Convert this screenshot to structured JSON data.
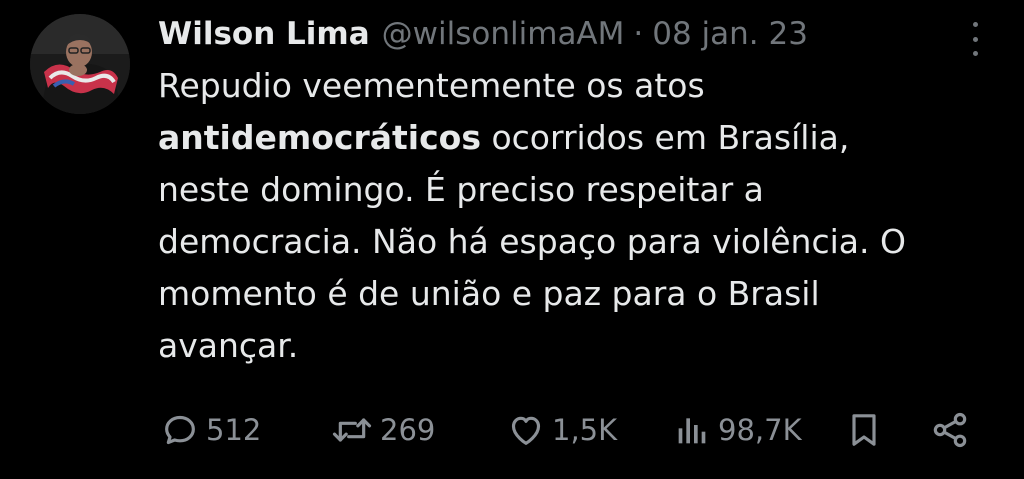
{
  "tweet": {
    "author": {
      "display_name": "Wilson Lima",
      "handle": "@wilsonlimaAM",
      "separator": "·",
      "date": "08 jan. 23"
    },
    "text_lines": [
      {
        "before": "Repudio veementemente os atos",
        "bold": "",
        "after": ""
      },
      {
        "before": "",
        "bold": "antidemocráticos",
        "after": " ocorridos em Brasília,"
      },
      {
        "before": "neste domingo. É preciso respeitar a",
        "bold": "",
        "after": ""
      },
      {
        "before": "democracia. Não há espaço para violência. O",
        "bold": "",
        "after": ""
      },
      {
        "before": "momento é de união e paz para o Brasil",
        "bold": "",
        "after": ""
      },
      {
        "before": "avançar.",
        "bold": "",
        "after": ""
      }
    ],
    "metrics": {
      "replies": "512",
      "retweets": "269",
      "likes": "1,5K",
      "views": "98,7K"
    },
    "icons": {
      "reply": "reply-icon",
      "retweet": "retweet-icon",
      "like": "heart-icon",
      "views": "views-icon",
      "bookmark": "bookmark-icon",
      "share": "share-icon",
      "more": "more-icon"
    }
  },
  "colors": {
    "background": "#000000",
    "text": "#e7e9ea",
    "secondary": "#71767b",
    "action": "#8b9096"
  }
}
